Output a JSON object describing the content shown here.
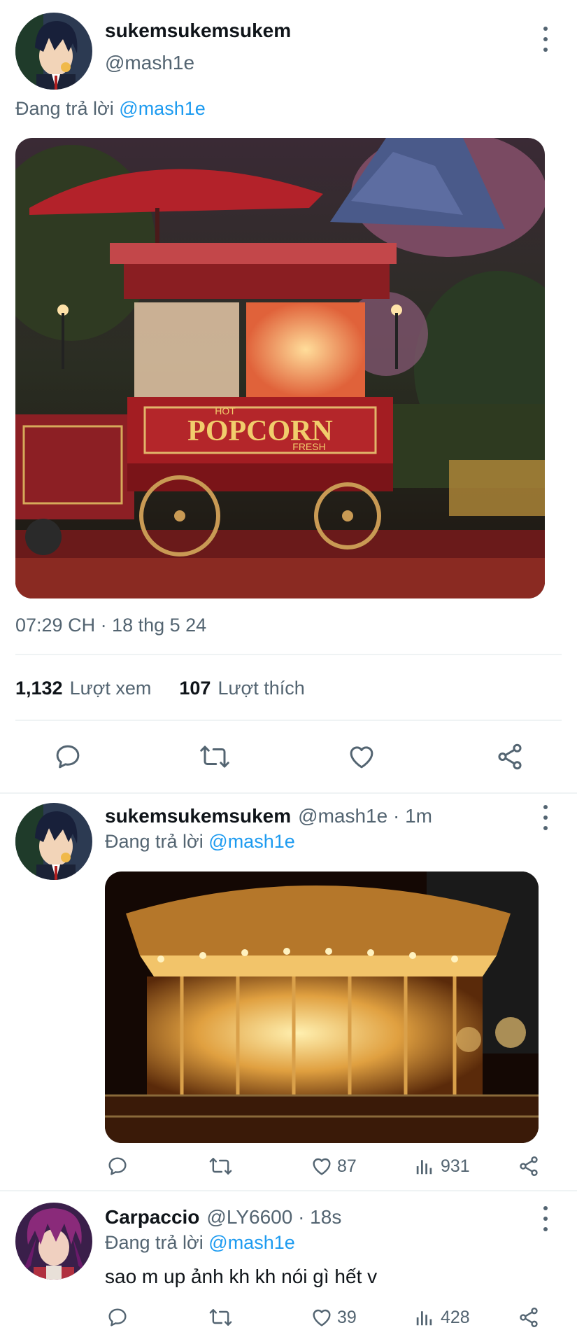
{
  "main_tweet": {
    "display_name": "sukemsukemsukem",
    "handle": "@mash1e",
    "replying_prefix": "Đang trả lời",
    "replying_to": "@mash1e",
    "image_caption": "POPCORN",
    "cart_hot": "HOT",
    "cart_fresh": "FRESH",
    "timestamp": "07:29 CH · 18 thg 5 24",
    "views_count": "1,132",
    "views_label": "Lượt xem",
    "likes_count": "107",
    "likes_label": "Lượt thích"
  },
  "replies": [
    {
      "display_name": "sukemsukemsukem",
      "handle": "@mash1e · 1m",
      "replying_prefix": "Đang trả lời",
      "replying_to": "@mash1e",
      "likes": "87",
      "views": "931"
    },
    {
      "display_name": "Carpaccio",
      "handle": "@LY6600 · 18s",
      "replying_prefix": "Đang trả lời",
      "replying_to": "@mash1e",
      "text": "sao m up ảnh kh kh nói gì hết v",
      "likes": "39",
      "views": "428"
    }
  ],
  "icons": {
    "reply": "reply-icon",
    "retweet": "retweet-icon",
    "like": "heart-icon",
    "views": "views-icon",
    "share": "share-icon",
    "more": "more-icon"
  },
  "colors": {
    "accent": "#1d9bf0",
    "muted": "#536471"
  }
}
